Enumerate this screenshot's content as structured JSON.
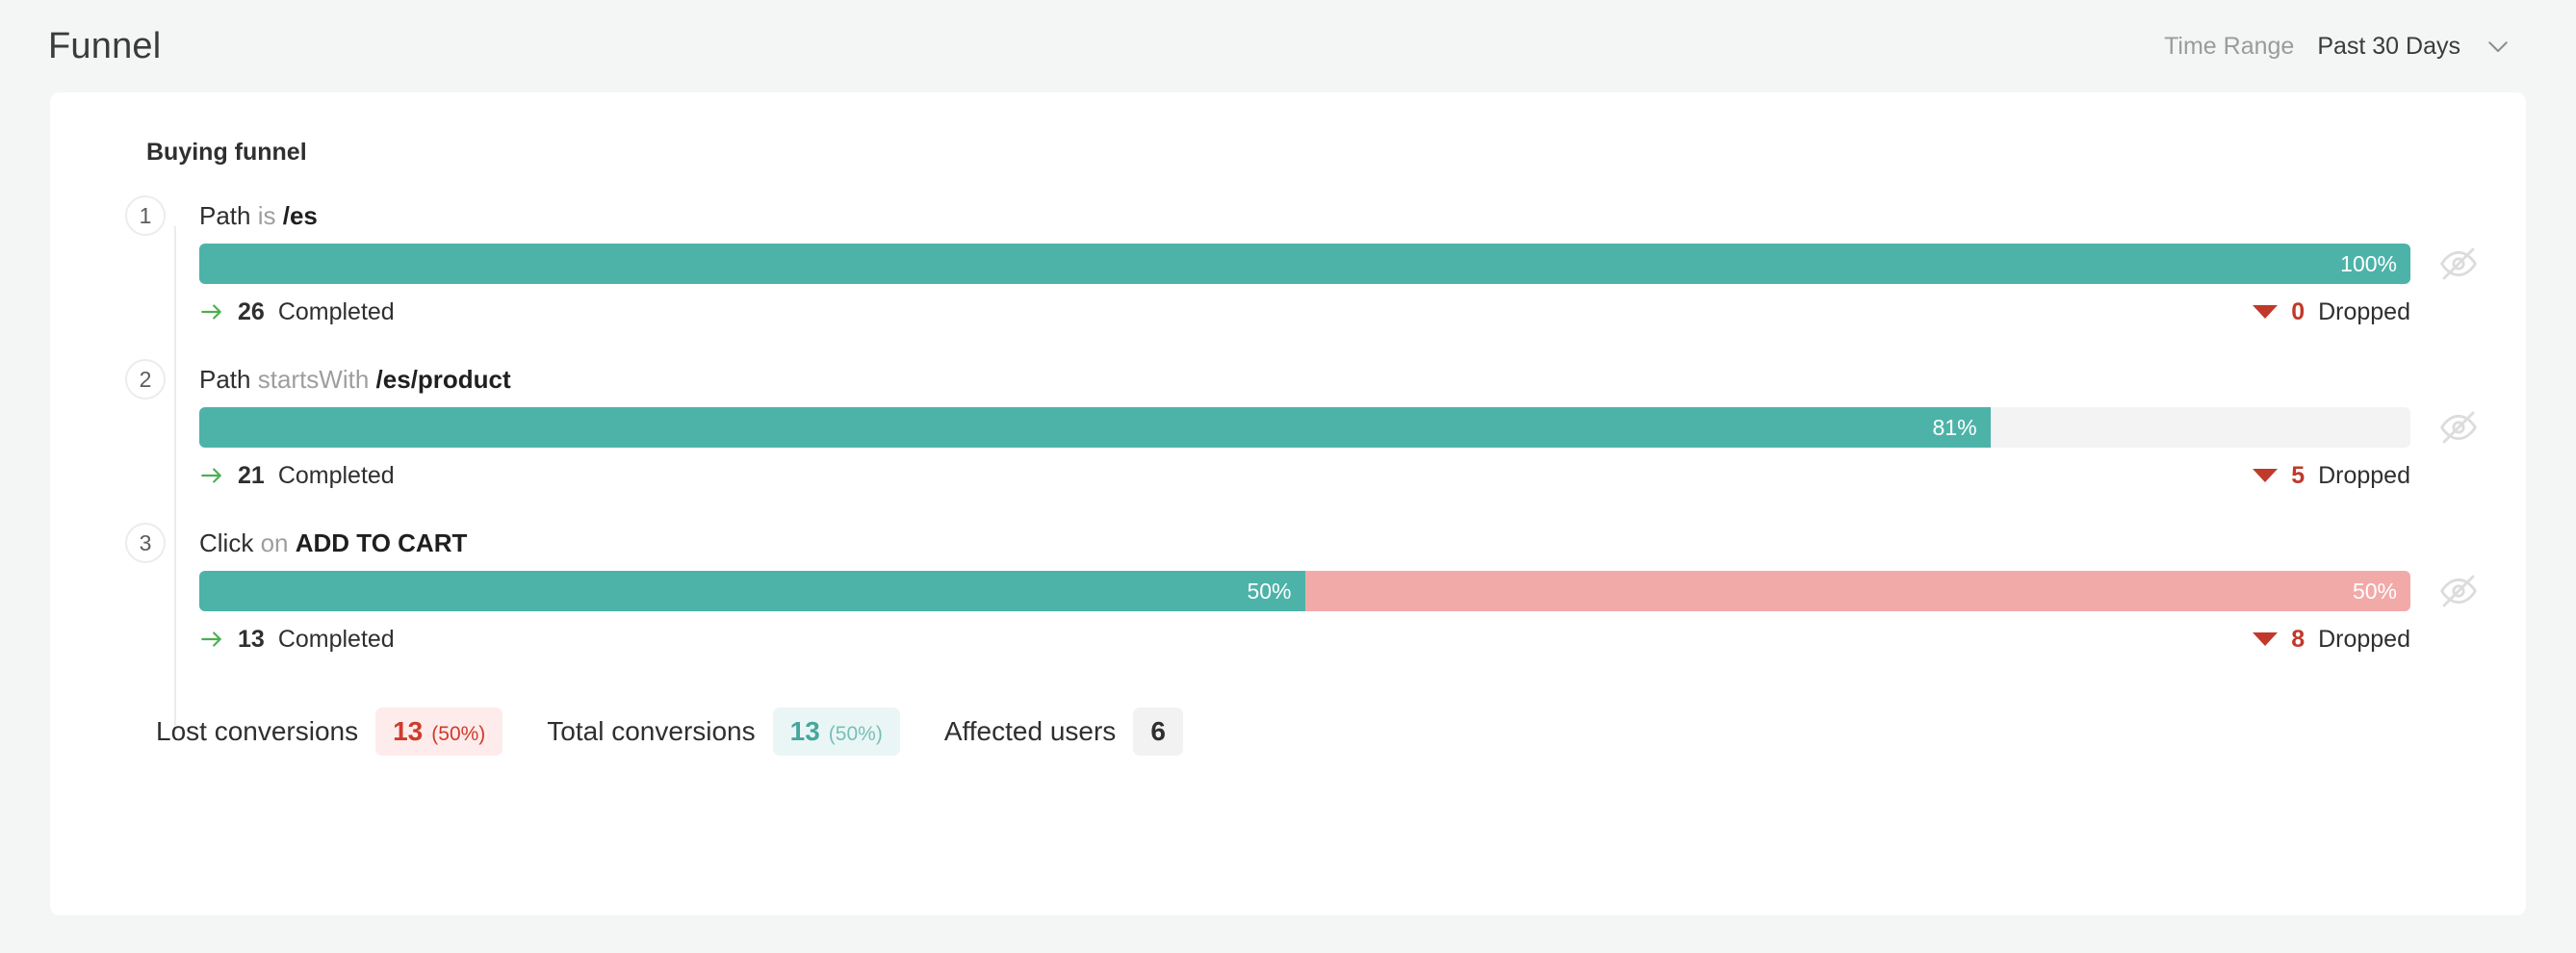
{
  "header": {
    "title": "Funnel",
    "time_range_label": "Time Range",
    "time_range_value": "Past 30 Days",
    "chevron_icon": "chevron-down-icon"
  },
  "card": {
    "title": "Buying funnel"
  },
  "steps": [
    {
      "number": "1",
      "event": "Path",
      "operator": "is",
      "value": "/es",
      "percent_label": "100%",
      "completed_count": "26",
      "completed_label": "Completed",
      "dropped_count": "0",
      "dropped_label": "Dropped",
      "completed_pct": 100,
      "dropped_pct": 0,
      "hide_icon": "eye-off-icon"
    },
    {
      "number": "2",
      "event": "Path",
      "operator": "startsWith",
      "value": "/es/product",
      "percent_label": "81%",
      "completed_count": "21",
      "completed_label": "Completed",
      "dropped_count": "5",
      "dropped_label": "Dropped",
      "completed_pct": 81,
      "dropped_pct": 0,
      "hide_icon": "eye-off-icon"
    },
    {
      "number": "3",
      "event": "Click",
      "operator": "on",
      "value": "ADD TO CART",
      "percent_label": "50%",
      "drop_percent_label": "50%",
      "completed_count": "13",
      "completed_label": "Completed",
      "dropped_count": "8",
      "dropped_label": "Dropped",
      "completed_pct": 50,
      "dropped_pct": 50,
      "hide_icon": "eye-off-icon"
    }
  ],
  "summary": [
    {
      "label": "Lost conversions",
      "value": "13",
      "pct": "(50%)",
      "style": "lost"
    },
    {
      "label": "Total conversions",
      "value": "13",
      "pct": "(50%)",
      "style": "total"
    },
    {
      "label": "Affected users",
      "value": "6",
      "pct": "",
      "style": "users"
    }
  ],
  "colors": {
    "completed_bar": "#4db3a9",
    "dropped_bar": "#f2aaa8",
    "track": "#f3f3f3",
    "dropped_text": "#c0392b",
    "completed_arrow": "#4caf50",
    "page_background": "#f4f5f5",
    "card_background": "#ffffff"
  },
  "chart_data": {
    "type": "bar",
    "title": "Buying funnel",
    "categories": [
      "Path is /es",
      "Path startsWith /es/product",
      "Click on ADD TO CART"
    ],
    "series": [
      {
        "name": "Completed %",
        "values": [
          100,
          81,
          50
        ]
      },
      {
        "name": "Dropped %",
        "values": [
          0,
          0,
          50
        ]
      }
    ],
    "completed_counts": [
      26,
      21,
      13
    ],
    "dropped_counts": [
      0,
      5,
      8
    ],
    "ylim": [
      0,
      100
    ],
    "xlabel": "",
    "ylabel": "",
    "grid": false,
    "legend": "none"
  }
}
